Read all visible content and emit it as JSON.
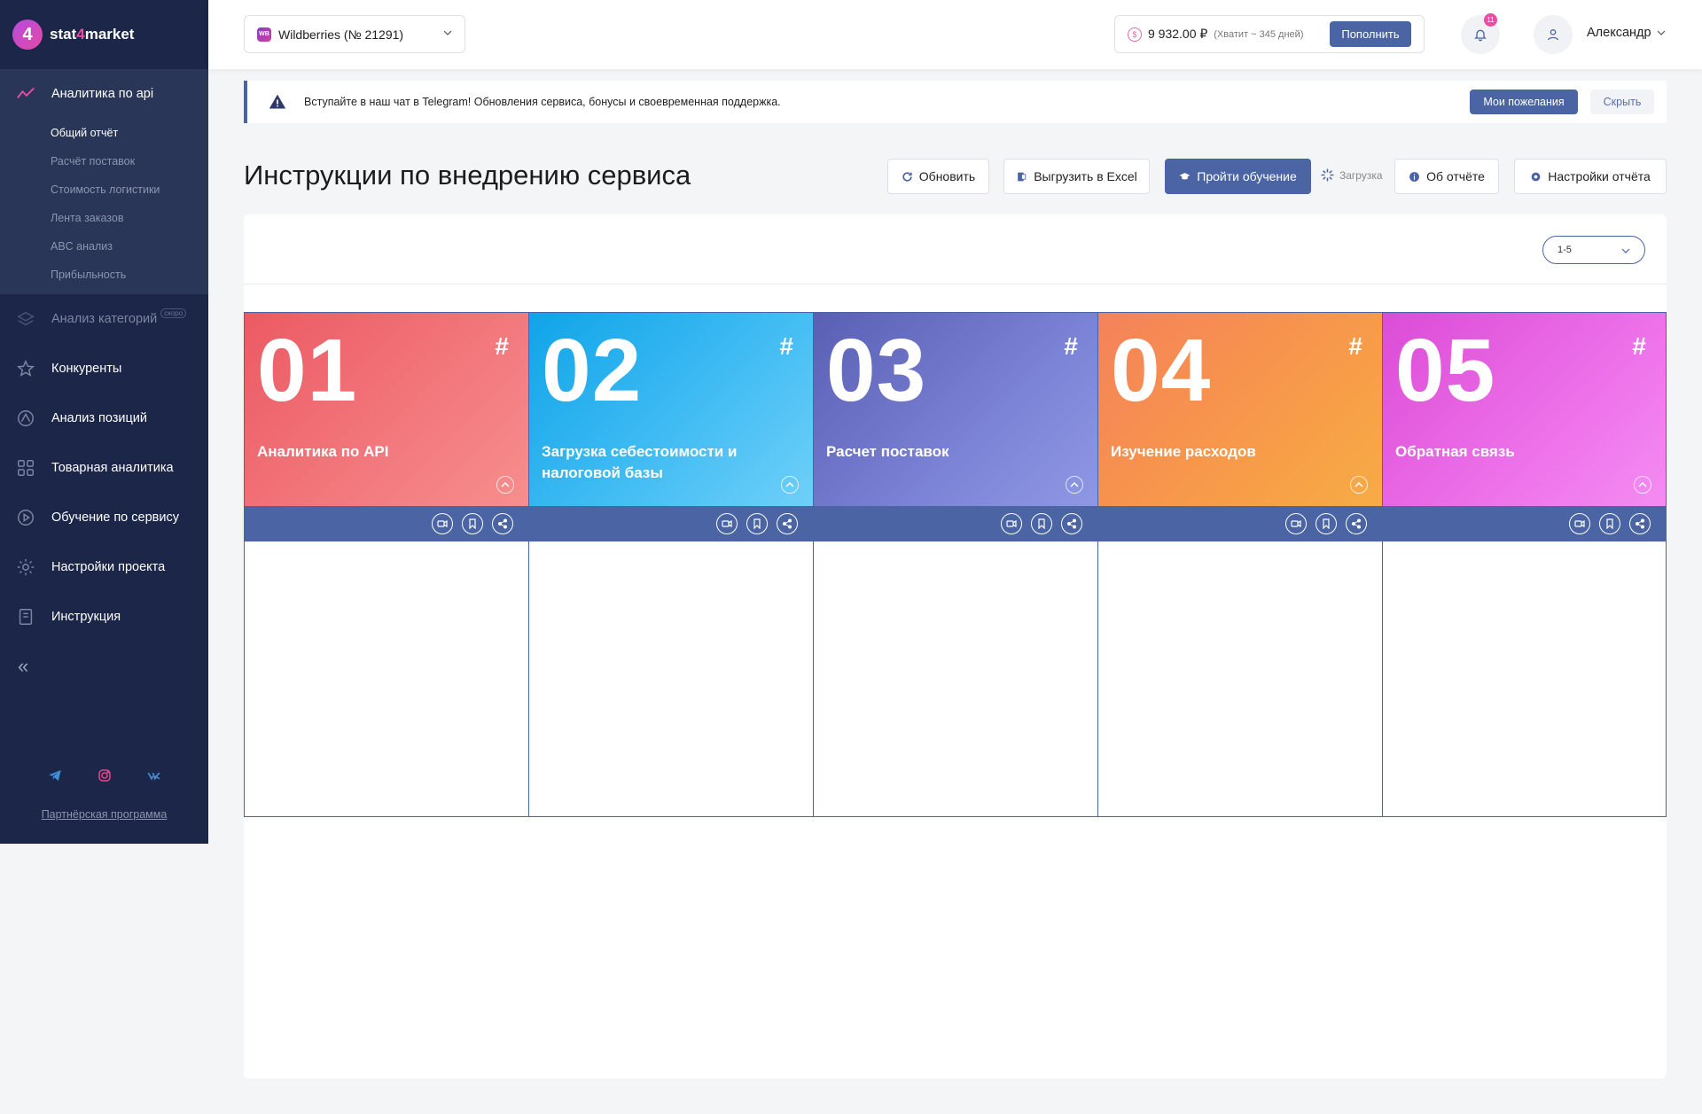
{
  "brand": {
    "name_prefix": "stat",
    "name_four": "4",
    "name_suffix": "market"
  },
  "sidebar": {
    "section_active": {
      "label": "Аналитика по api",
      "icon": "chart-line-icon"
    },
    "sub_items": [
      {
        "label": "Общий отчёт",
        "active": true
      },
      {
        "label": "Расчёт поставок",
        "active": false
      },
      {
        "label": "Стоимость логистики",
        "active": false
      },
      {
        "label": "Лента заказов",
        "active": false
      },
      {
        "label": "ABC анализ",
        "active": false
      },
      {
        "label": "Прибыльность",
        "active": false
      }
    ],
    "items": [
      {
        "label": "Анализ категорий",
        "icon": "layers-icon",
        "badge": "скоро",
        "dim": true
      },
      {
        "label": "Конкуренты",
        "icon": "star-icon"
      },
      {
        "label": "Анализ позиций",
        "icon": "position-icon"
      },
      {
        "label": "Товарная аналитика",
        "icon": "grid-icon"
      },
      {
        "label": "Обучение по сервису",
        "icon": "play-icon"
      },
      {
        "label": "Настройки проекта",
        "icon": "gear-icon"
      },
      {
        "label": "Инструкция",
        "icon": "document-icon"
      }
    ],
    "collapse_glyph": "«",
    "socials": [
      "telegram-icon",
      "instagram-icon",
      "vk-icon"
    ],
    "partner_link": "Партнёрская программа"
  },
  "header": {
    "store": "Wildberries (№ 21291)",
    "store_icon_text": "WB",
    "balance": "9 932.00 ₽",
    "balance_note": "(Хватит ~ 345 дней)",
    "topup_label": "Пополнить",
    "notifications_count": "11",
    "user_name": "Александр"
  },
  "notice": {
    "text": "Вступайте в наш чат в Telegram! Обновления сервиса, бонусы и своевременная поддержка.",
    "wishes_label": "Мои пожелания",
    "hide_label": "Скрыть"
  },
  "page": {
    "title": "Инструкции по внедрению сервиса",
    "toolbar": {
      "refresh": "Обновить",
      "export": "Выгрузить в Excel",
      "training": "Пройти обучение",
      "loading": "Загрузка",
      "about": "Об отчёте",
      "settings": "Настройки отчёта"
    },
    "range_select": "1-5"
  },
  "cards": [
    {
      "num": "01",
      "hash": "#",
      "title": "Аналитика по API"
    },
    {
      "num": "02",
      "hash": "#",
      "title": "Загрузка себестоимости и налоговой базы"
    },
    {
      "num": "03",
      "hash": "#",
      "title": "Расчет поставок"
    },
    {
      "num": "04",
      "hash": "#",
      "title": "Изучение расходов"
    },
    {
      "num": "05",
      "hash": "#",
      "title": "Обратная связь"
    }
  ],
  "colors": {
    "sidebar": "#1b2648",
    "accent": "#4a64a4",
    "pink": "#e94ea5",
    "card_red": "#ec5a63",
    "card_blue": "#10a4e8",
    "card_indigo": "#5a5fb3",
    "card_orange": "#f5825a",
    "card_magenta": "#db4cd6"
  }
}
